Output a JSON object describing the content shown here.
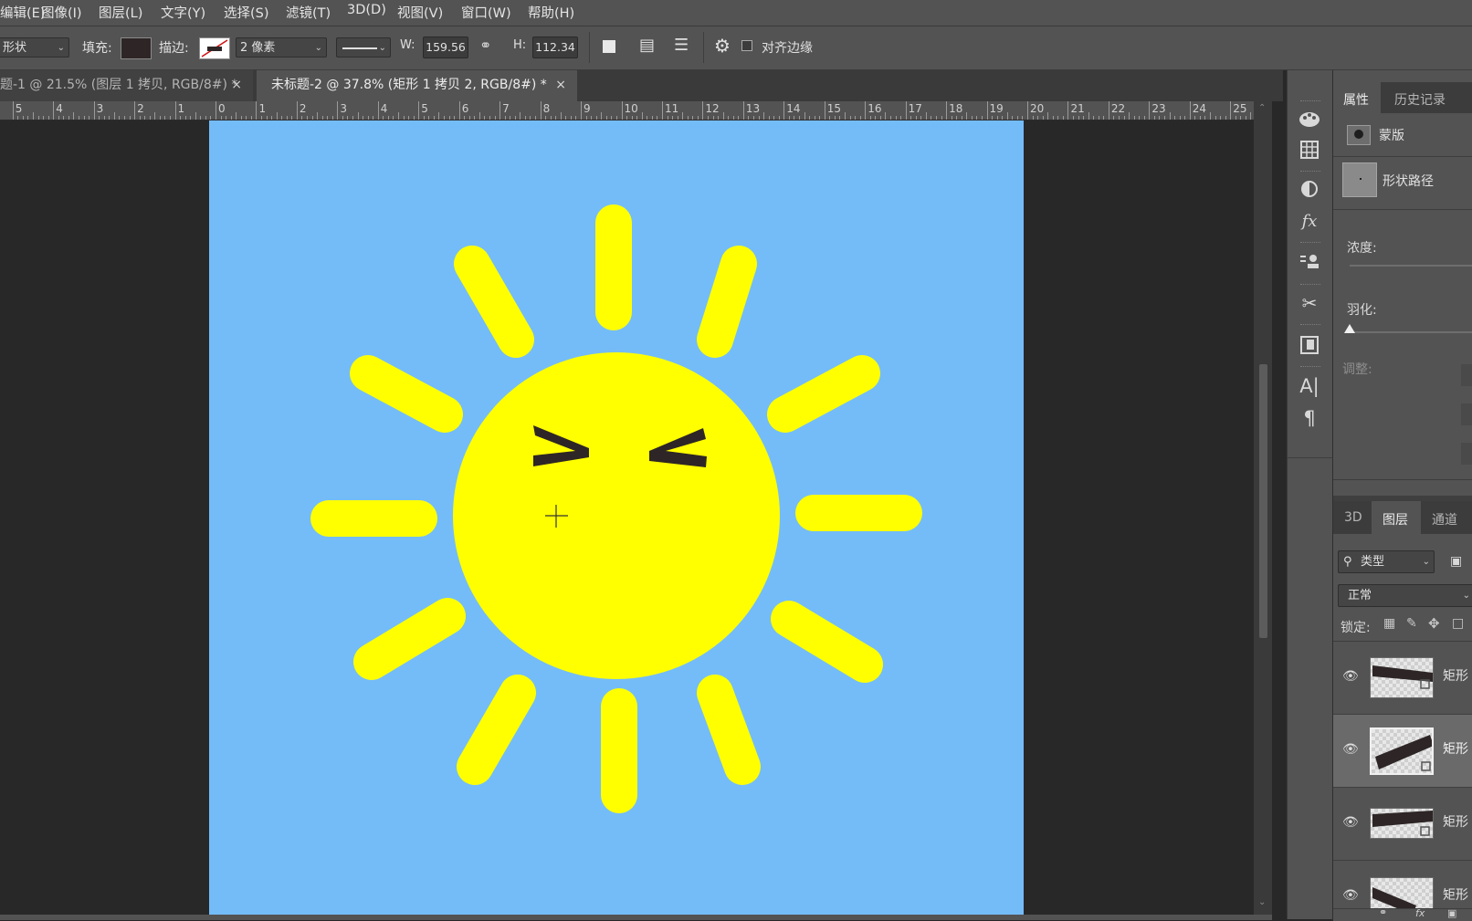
{
  "menu": [
    "编辑(E)",
    "图像(I)",
    "图层(L)",
    "文字(Y)",
    "选择(S)",
    "滤镜(T)",
    "3D(D)",
    "视图(V)",
    "窗口(W)",
    "帮助(H)"
  ],
  "options": {
    "mode": "形状",
    "fill_label": "填充:",
    "fill_color": "#2e2626",
    "stroke_label": "描边:",
    "stroke_width": "2 像素",
    "w_label": "W:",
    "w_value": "159.56",
    "h_label": "H:",
    "h_value": "112.34",
    "align_edges_label": "对齐边缘",
    "align_edges_checked": false
  },
  "tabs": [
    {
      "label": "题-1 @ 21.5% (图层 1 拷贝, RGB/8#) *",
      "active": false
    },
    {
      "label": "未标题-2 @ 37.8% (矩形 1 拷贝 2, RGB/8#) *",
      "active": true
    }
  ],
  "ruler": {
    "labels": [
      "5",
      "4",
      "3",
      "2",
      "1",
      "0",
      "1",
      "2",
      "3",
      "4",
      "5",
      "6",
      "7",
      "8",
      "9",
      "10",
      "11",
      "12",
      "13",
      "14",
      "15",
      "16",
      "17",
      "18",
      "19",
      "20",
      "21",
      "22",
      "23",
      "24",
      "25"
    ]
  },
  "canvas": {
    "background": "#74bcf8",
    "sun_color": "#ffff00",
    "eye_color": "#2e2626"
  },
  "tool_icons": [
    "palette-icon",
    "grid-icon",
    "adjust-icon",
    "fx-icon",
    "stamp-icon",
    "scissors-icon",
    "library-icon",
    "character-icon",
    "paragraph-icon"
  ],
  "properties": {
    "tabs": [
      "属性",
      "历史记录"
    ],
    "mask_label": "蒙版",
    "path_label": "形状路径",
    "density_label": "浓度:",
    "feather_label": "羽化:",
    "adjust_label": "调整:"
  },
  "layers_panel": {
    "tabs": [
      "3D",
      "图层",
      "通道"
    ],
    "filter_label": "类型",
    "blend_mode": "正常",
    "lock_label": "锁定:",
    "layers": [
      {
        "name": "矩形",
        "selected": false
      },
      {
        "name": "矩形",
        "selected": true
      },
      {
        "name": "矩形",
        "selected": false
      },
      {
        "name": "矩形",
        "selected": false
      }
    ]
  }
}
